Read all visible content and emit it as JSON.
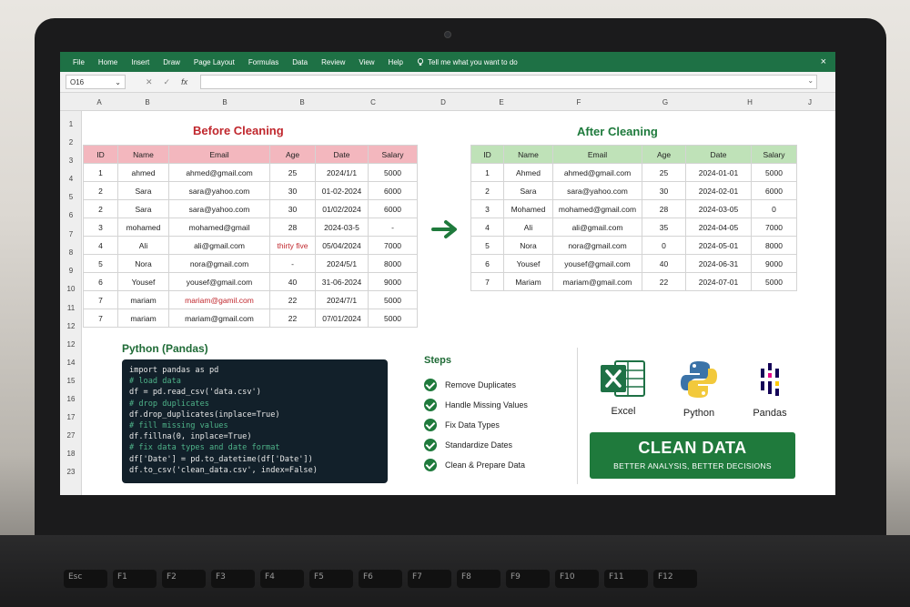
{
  "ribbon": {
    "menus": [
      "File",
      "Home",
      "Insert",
      "Draw",
      "Page Layout",
      "Formulas",
      "Data",
      "Review",
      "View",
      "Help"
    ],
    "tell_me": "Tell me what you want to do",
    "close": "×"
  },
  "formula_bar": {
    "name_box": "O16",
    "formula": ""
  },
  "column_headers": [
    "A",
    "B",
    "B",
    "B",
    "C",
    "D",
    "E",
    "F",
    "G",
    "H",
    "J"
  ],
  "row_numbers": [
    "1",
    "2",
    "3",
    "4",
    "5",
    "6",
    "7",
    "8",
    "9",
    "10",
    "11",
    "12",
    "12",
    "14",
    "15",
    "16",
    "17",
    "27",
    "18",
    "23"
  ],
  "before": {
    "title": "Before Cleaning",
    "headers": [
      "ID",
      "Name",
      "Email",
      "Age",
      "Date",
      "Salary"
    ],
    "rows": [
      [
        "1",
        "ahmed",
        "ahmed@gmail.com",
        "25",
        "2024/1/1",
        "5000"
      ],
      [
        "2",
        "Sara",
        "sara@yahoo.com",
        "30",
        "01-02-2024",
        "6000"
      ],
      [
        "2",
        "Sara",
        "sara@yahoo.com",
        "30",
        "01/02/2024",
        "6000"
      ],
      [
        "3",
        "mohamed",
        "mohamed@gmail",
        "28",
        "2024-03-5",
        "-"
      ],
      [
        "4",
        "Ali",
        "ali@gmail.com",
        "thirty five",
        "05/04/2024",
        "7000"
      ],
      [
        "5",
        "Nora",
        "nora@gmail.com",
        "-",
        "2024/5/1",
        "8000"
      ],
      [
        "6",
        "Yousef",
        "yousef@gmail.com",
        "40",
        "31-06-2024",
        "9000"
      ],
      [
        "7",
        "mariam",
        "mariam@gamil.com",
        "22",
        "2024/7/1",
        "5000"
      ],
      [
        "7",
        "mariam",
        "mariam@gmail.com",
        "22",
        "07/01/2024",
        "5000"
      ]
    ]
  },
  "after": {
    "title": "After Cleaning",
    "headers": [
      "ID",
      "Name",
      "Email",
      "Age",
      "Date",
      "Salary"
    ],
    "rows": [
      [
        "1",
        "Ahmed",
        "ahmed@gmail.com",
        "25",
        "2024-01-01",
        "5000"
      ],
      [
        "2",
        "Sara",
        "sara@yahoo.com",
        "30",
        "2024-02-01",
        "6000"
      ],
      [
        "3",
        "Mohamed",
        "mohamed@gmail.com",
        "28",
        "2024-03-05",
        "0"
      ],
      [
        "4",
        "Ali",
        "ali@gmail.com",
        "35",
        "2024-04-05",
        "7000"
      ],
      [
        "5",
        "Nora",
        "nora@gmail.com",
        "0",
        "2024-05-01",
        "8000"
      ],
      [
        "6",
        "Yousef",
        "yousef@gmail.com",
        "40",
        "2024-06-31",
        "9000"
      ],
      [
        "7",
        "Mariam",
        "mariam@gmail.com",
        "22",
        "2024-07-01",
        "5000"
      ]
    ]
  },
  "python": {
    "title": "Python (Pandas)",
    "lines": [
      {
        "t": "import pandas as pd",
        "k": "code"
      },
      {
        "t": "# load data",
        "k": "cm"
      },
      {
        "t": "df = pd.read_csv('data.csv')",
        "k": "code"
      },
      {
        "t": "# drop duplicates",
        "k": "cm"
      },
      {
        "t": "df.drop_duplicates(inplace=True)",
        "k": "code"
      },
      {
        "t": "# fill missing values",
        "k": "cm"
      },
      {
        "t": "df.fillna(0, inplace=True)",
        "k": "code"
      },
      {
        "t": "# fix data types and date format",
        "k": "cm"
      },
      {
        "t": "df['Date'] = pd.to_datetime(df['Date'])",
        "k": "code"
      },
      {
        "t": "df.to_csv('clean_data.csv', index=False)",
        "k": "code"
      }
    ]
  },
  "steps": {
    "title": "Steps",
    "items": [
      "Remove Duplicates",
      "Handle Missing Values",
      "Fix Data Types",
      "Standardize Dates",
      "Clean & Prepare Data"
    ]
  },
  "tools": {
    "excel": "Excel",
    "python": "Python",
    "pandas": "Pandas"
  },
  "banner": {
    "title": "CLEAN DATA",
    "subtitle": "BETTER ANALYSIS, BETTER DECISIONS"
  },
  "keyboard": [
    "Esc",
    "F1",
    "F2",
    "F3",
    "F4",
    "F5",
    "F6",
    "F7",
    "F8",
    "F9",
    "F10",
    "F11",
    "F12"
  ],
  "colors": {
    "excel_green": "#1e7145",
    "accent_red": "#c0272d",
    "before_header": "#f3b7be",
    "after_header": "#bfe2b8",
    "code_bg": "#12202a"
  }
}
